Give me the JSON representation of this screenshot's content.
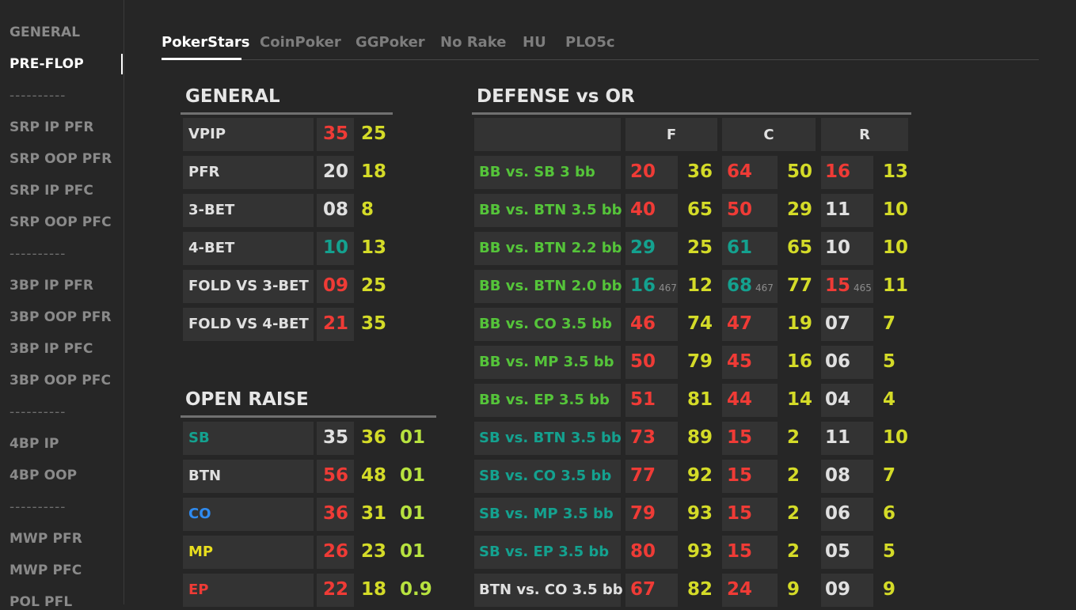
{
  "colors": {
    "red": "#ef3b36",
    "yellow": "#d4db28",
    "teal": "#14a18f",
    "white": "#e0e0e0",
    "lime": "#b7e23f",
    "green": "#55c43a",
    "blue": "#2f8bf0",
    "gold": "#e8de1e"
  },
  "sidebar": {
    "items": [
      "GENERAL",
      "PRE-FLOP",
      "----------",
      "SRP IP PFR",
      "SRP OOP PFR",
      "SRP IP PFC",
      "SRP OOP PFC",
      "----------",
      "3BP IP PFR",
      "3BP OOP PFR",
      "3BP IP PFC",
      "3BP OOP PFC",
      "----------",
      "4BP IP",
      "4BP OOP",
      "----------",
      "MWP PFR",
      "MWP PFC",
      "POL PFL"
    ],
    "active": "PRE-FLOP"
  },
  "tabs": [
    "PokerStars",
    "CoinPoker",
    "GGPoker",
    "No Rake",
    "HU",
    "PLO5c"
  ],
  "active_tab": "PokerStars",
  "general": {
    "title": "GENERAL",
    "rows": [
      {
        "label": "VPIP",
        "v1": "35",
        "v2": "25",
        "c1": "red"
      },
      {
        "label": "PFR",
        "v1": "20",
        "v2": "18",
        "c1": "white"
      },
      {
        "label": "3-BET",
        "v1": "08",
        "v2": "8",
        "c1": "white"
      },
      {
        "label": "4-BET",
        "v1": "10",
        "v2": "13",
        "c1": "teal"
      },
      {
        "label": "FOLD VS 3-BET",
        "v1": "09",
        "v2": "25",
        "c1": "red"
      },
      {
        "label": "FOLD VS 4-BET",
        "v1": "21",
        "v2": "35",
        "c1": "red"
      }
    ]
  },
  "open_raise": {
    "title": "OPEN RAISE",
    "rows": [
      {
        "label": "SB",
        "lc": "teal",
        "v1": "35",
        "c1": "white",
        "v2": "36",
        "v3": "01"
      },
      {
        "label": "BTN",
        "lc": "white",
        "v1": "56",
        "c1": "red",
        "v2": "48",
        "v3": "01"
      },
      {
        "label": "CO",
        "lc": "blue",
        "v1": "36",
        "c1": "red",
        "v2": "31",
        "v3": "01"
      },
      {
        "label": "MP",
        "lc": "gold",
        "v1": "26",
        "c1": "red",
        "v2": "23",
        "v3": "01"
      },
      {
        "label": "EP",
        "lc": "red",
        "v1": "22",
        "c1": "red",
        "v2": "18",
        "v3": "0.9"
      }
    ]
  },
  "defense": {
    "title": "DEFENSE vs OR",
    "headers": [
      "F",
      "C",
      "R"
    ],
    "rows": [
      {
        "label": "BB vs. SB 3 bb",
        "lc": "green",
        "f": "20",
        "fc": "red",
        "f2": "36",
        "c": "64",
        "cc": "red",
        "c2": "50",
        "r": "16",
        "rc": "red",
        "r2": "13"
      },
      {
        "label": "BB vs. BTN 3.5 bb",
        "lc": "green",
        "f": "40",
        "fc": "red",
        "f2": "65",
        "c": "50",
        "cc": "red",
        "c2": "29",
        "r": "11",
        "rc": "white",
        "r2": "10"
      },
      {
        "label": "BB vs. BTN 2.2 bb",
        "lc": "green",
        "f": "29",
        "fc": "teal",
        "f2": "25",
        "c": "61",
        "cc": "teal",
        "c2": "65",
        "r": "10",
        "rc": "white",
        "r2": "10"
      },
      {
        "label": "BB vs. BTN 2.0 bb",
        "lc": "green",
        "f": "16",
        "fc": "teal",
        "fs": "467",
        "f2": "12",
        "c": "68",
        "cc": "teal",
        "cs": "467",
        "c2": "77",
        "r": "15",
        "rc": "red",
        "rs": "465",
        "r2": "11"
      },
      {
        "label": "BB vs. CO 3.5 bb",
        "lc": "green",
        "f": "46",
        "fc": "red",
        "f2": "74",
        "c": "47",
        "cc": "red",
        "c2": "19",
        "r": "07",
        "rc": "white",
        "r2": "7"
      },
      {
        "label": "BB vs. MP 3.5 bb",
        "lc": "green",
        "f": "50",
        "fc": "red",
        "f2": "79",
        "c": "45",
        "cc": "red",
        "c2": "16",
        "r": "06",
        "rc": "white",
        "r2": "5"
      },
      {
        "label": "BB vs. EP 3.5 bb",
        "lc": "green",
        "f": "51",
        "fc": "red",
        "f2": "81",
        "c": "44",
        "cc": "red",
        "c2": "14",
        "r": "04",
        "rc": "white",
        "r2": "4"
      },
      {
        "label": "SB vs. BTN 3.5 bb",
        "lc": "teal",
        "f": "73",
        "fc": "red",
        "f2": "89",
        "c": "15",
        "cc": "red",
        "c2": "2",
        "r": "11",
        "rc": "white",
        "r2": "10"
      },
      {
        "label": "SB vs. CO 3.5 bb",
        "lc": "teal",
        "f": "77",
        "fc": "red",
        "f2": "92",
        "c": "15",
        "cc": "red",
        "c2": "2",
        "r": "08",
        "rc": "white",
        "r2": "7"
      },
      {
        "label": "SB vs. MP 3.5 bb",
        "lc": "teal",
        "f": "79",
        "fc": "red",
        "f2": "93",
        "c": "15",
        "cc": "red",
        "c2": "2",
        "r": "06",
        "rc": "white",
        "r2": "6"
      },
      {
        "label": "SB vs. EP 3.5 bb",
        "lc": "teal",
        "f": "80",
        "fc": "red",
        "f2": "93",
        "c": "15",
        "cc": "red",
        "c2": "2",
        "r": "05",
        "rc": "white",
        "r2": "5"
      },
      {
        "label": "BTN vs. CO 3.5 bb",
        "lc": "white",
        "f": "67",
        "fc": "red",
        "f2": "82",
        "c": "24",
        "cc": "red",
        "c2": "9",
        "r": "09",
        "rc": "white",
        "r2": "9"
      }
    ]
  }
}
